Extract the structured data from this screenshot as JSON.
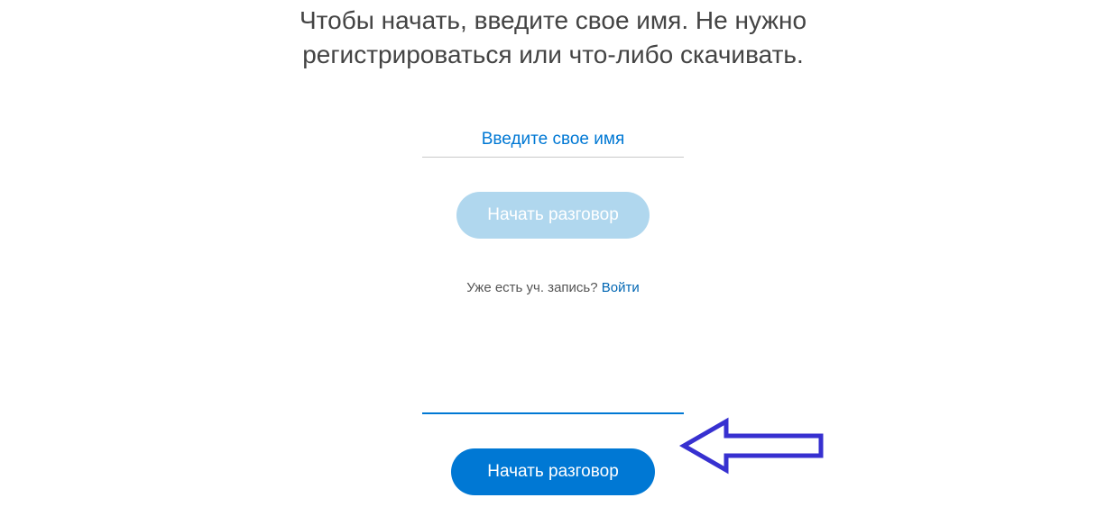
{
  "subtitle": "Чтобы начать, введите свое имя. Не нужно регистрироваться или что-либо скачивать.",
  "name_input": {
    "placeholder": "Введите свое имя",
    "value": ""
  },
  "start_button_disabled": "Начать разговор",
  "already": {
    "text": "Уже есть уч. запись? ",
    "link": "Войти"
  },
  "second_input": {
    "value": ""
  },
  "start_button_primary": "Начать разговор"
}
